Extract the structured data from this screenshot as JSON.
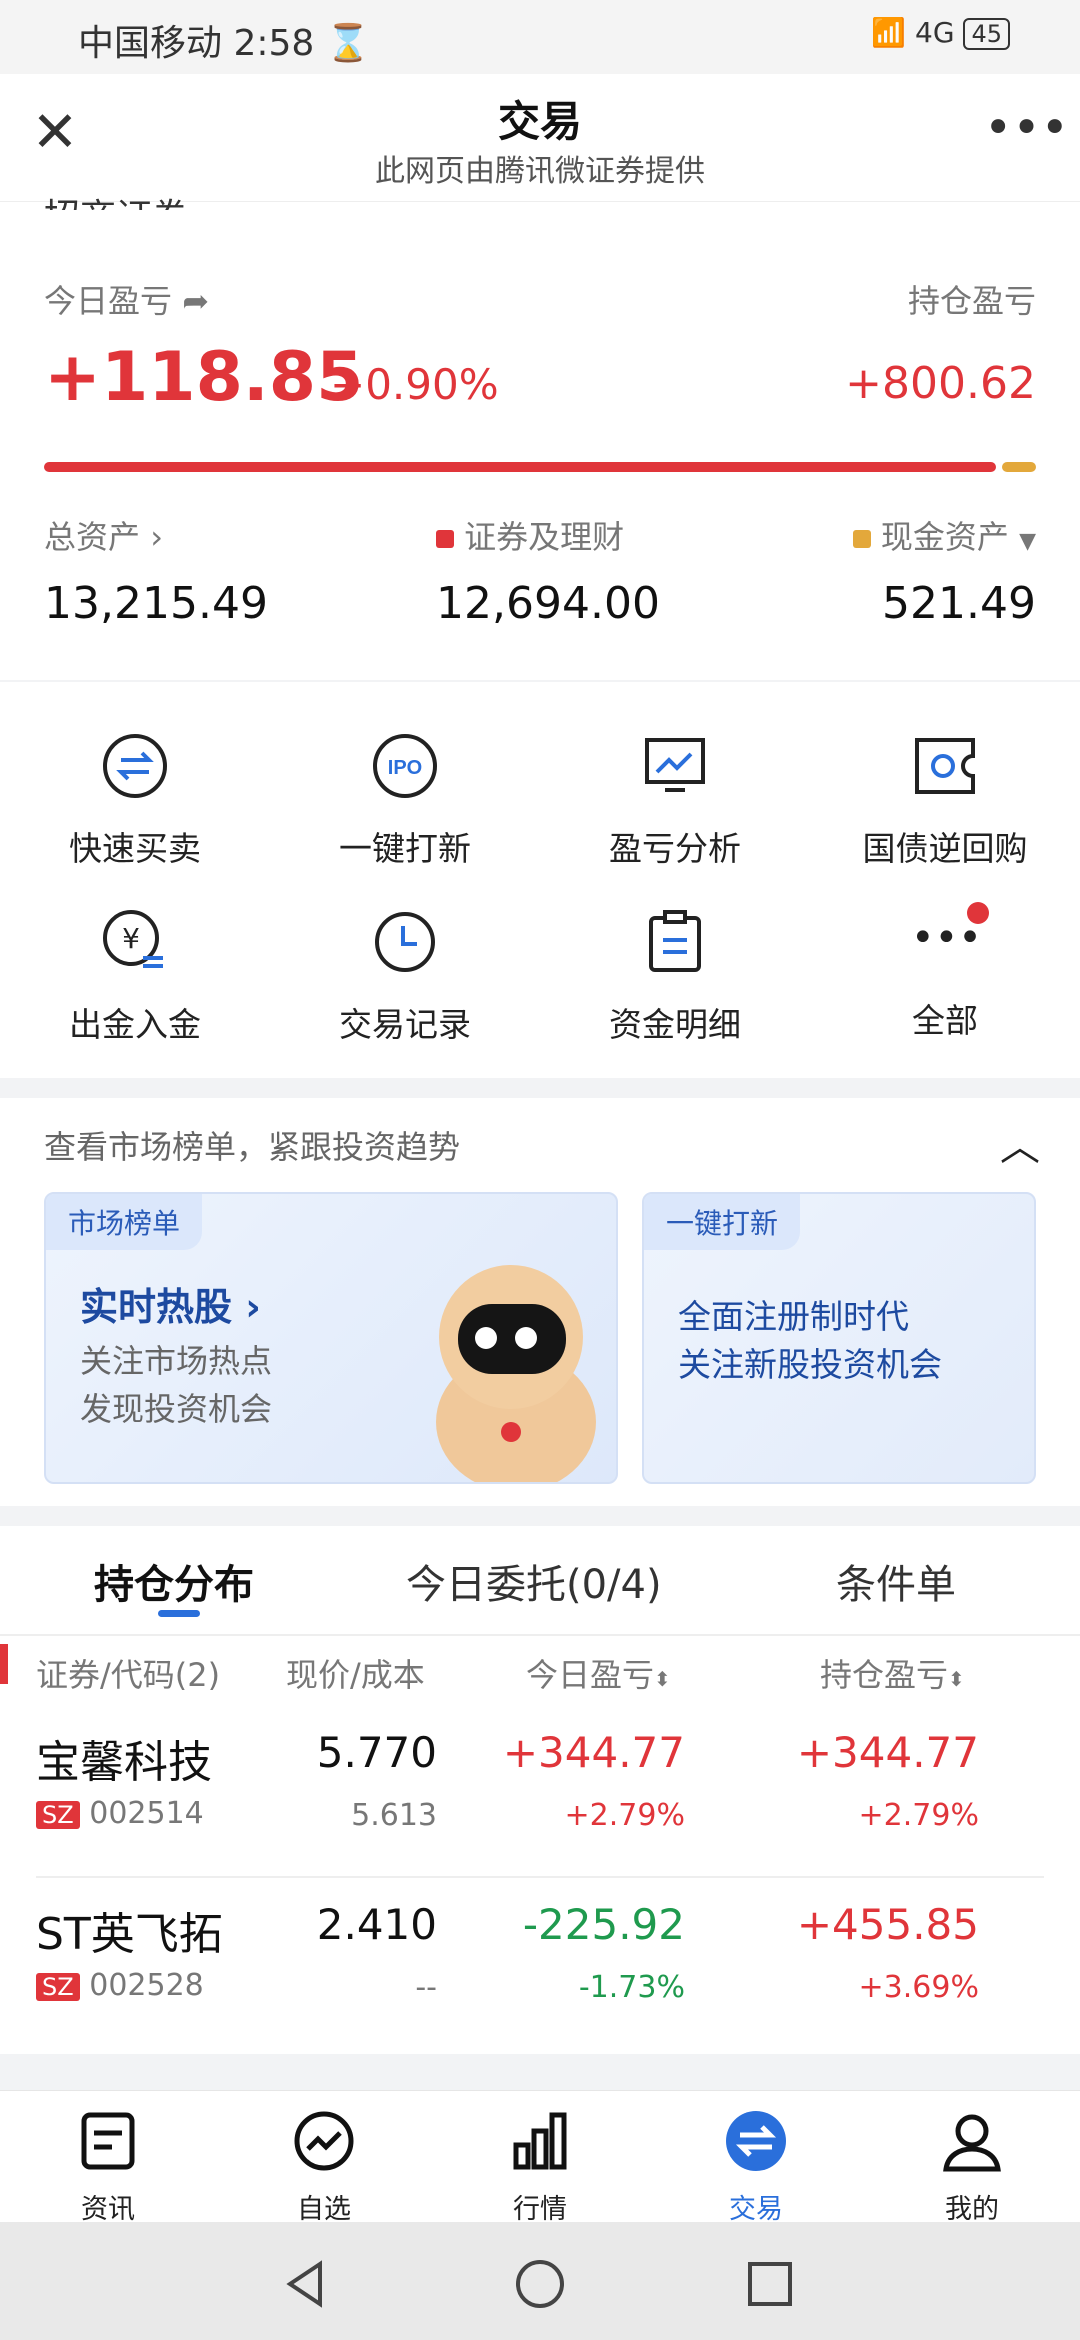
{
  "status": {
    "carrier": "中国移动",
    "time": "2:58",
    "signal": "4G",
    "battery": "45"
  },
  "titlebar": {
    "title": "交易",
    "subtitle": "此网页由腾讯微证券提供"
  },
  "broker": {
    "name": "招商证券"
  },
  "pnl": {
    "today_label": "今日盈亏",
    "today_value": "+118.85",
    "today_pct": "+0.90%",
    "hold_label": "持仓盈亏",
    "hold_value": "+800.62",
    "securities_share": 0.96
  },
  "assets": {
    "total_label": "总资产",
    "total_value": "13,215.49",
    "sec_label": "证券及理财",
    "sec_value": "12,694.00",
    "cash_label": "现金资产",
    "cash_value": "521.49"
  },
  "grid": [
    {
      "label": "快速买卖",
      "icon": "swap-icon"
    },
    {
      "label": "一键打新",
      "icon": "ipo-icon"
    },
    {
      "label": "盈亏分析",
      "icon": "chart-icon"
    },
    {
      "label": "国债逆回购",
      "icon": "repo-icon"
    },
    {
      "label": "出金入金",
      "icon": "yuan-transfer-icon"
    },
    {
      "label": "交易记录",
      "icon": "clock-icon"
    },
    {
      "label": "资金明细",
      "icon": "clipboard-icon"
    },
    {
      "label": "全部",
      "icon": "more-icon"
    }
  ],
  "market": {
    "header": "查看市场榜单，紧跟投资趋势",
    "card1": {
      "tag": "市场榜单",
      "title": "实时热股",
      "line1": "关注市场热点",
      "line2": "发现投资机会"
    },
    "card2": {
      "tag": "一键打新",
      "line1": "全面注册制时代",
      "line2": "关注新股投资机会"
    }
  },
  "tabs": [
    "持仓分布",
    "今日委托(0/4)",
    "条件单"
  ],
  "table": {
    "headers": [
      "证券/代码(2)",
      "现价/成本",
      "今日盈亏",
      "持仓盈亏"
    ],
    "rows": [
      {
        "name": "宝馨科技",
        "market": "SZ",
        "code": "002514",
        "price": "5.770",
        "cost": "5.613",
        "today": "+344.77",
        "today_pct": "+2.79%",
        "hold": "+344.77",
        "hold_pct": "+2.79%",
        "today_color": "red",
        "hold_color": "red"
      },
      {
        "name": "ST英飞拓",
        "market": "SZ",
        "code": "002528",
        "price": "2.410",
        "cost": "--",
        "today": "-225.92",
        "today_pct": "-1.73%",
        "hold": "+455.85",
        "hold_pct": "+3.69%",
        "today_color": "green",
        "hold_color": "red"
      }
    ]
  },
  "bottomnav": [
    {
      "label": "资讯",
      "icon": "news-icon"
    },
    {
      "label": "自选",
      "icon": "trend-icon"
    },
    {
      "label": "行情",
      "icon": "bars-icon"
    },
    {
      "label": "交易",
      "icon": "trade-icon",
      "active": true
    },
    {
      "label": "我的",
      "icon": "user-icon"
    }
  ],
  "colors": {
    "red": "#e0353a",
    "green": "#1f9a4e",
    "blue": "#2a6fdb",
    "gold": "#e3a83b"
  }
}
